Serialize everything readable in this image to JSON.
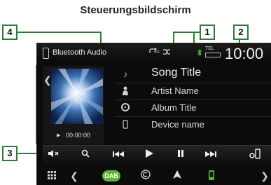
{
  "heading": "Steuerungsbildschirm",
  "callouts": {
    "c1": "1",
    "c2": "2",
    "c3": "3",
    "c4": "4"
  },
  "title_bar": {
    "source": "Bluetooth Audio",
    "repeat_icon": "repeat-all-icon",
    "repeat_label": "ALL",
    "shuffle_icon": "shuffle-icon",
    "tel_label": "TEL",
    "clock": "10:00"
  },
  "artwork": {
    "time": "00:00:00"
  },
  "track_info": {
    "song_title": "Song Title",
    "artist_name": "Artist Name",
    "album_title": "Album Title",
    "device_name": "Device name"
  },
  "controls": [
    {
      "icon": "mute-icon"
    },
    {
      "icon": "search-icon"
    },
    {
      "icon": "previous-track-icon"
    },
    {
      "icon": "play-icon"
    },
    {
      "icon": "pause-icon"
    },
    {
      "icon": "next-track-icon"
    },
    {
      "icon": "device-settings-icon"
    }
  ],
  "nav": {
    "dab_label": "DAB"
  },
  "colors": {
    "callout": "#2f7a3a",
    "dab": "#5fb734",
    "screen_bg": "#0b0b0b"
  }
}
